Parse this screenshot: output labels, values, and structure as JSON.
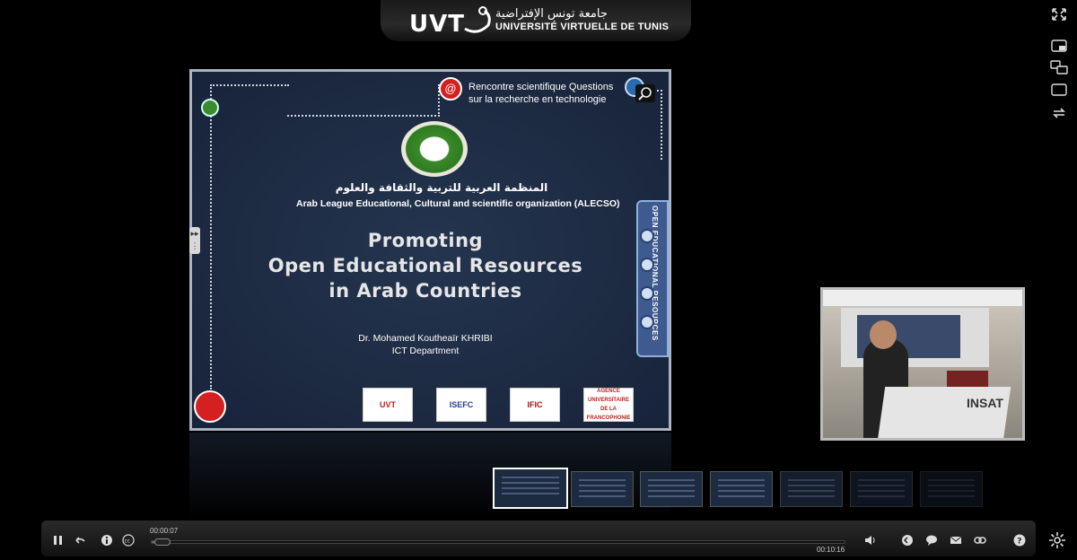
{
  "header": {
    "logo_text": "UVT",
    "arabic_name": "جامعة تونس الإفتراضية",
    "french_name": "UNIVERSITÉ VIRTUELLE DE TUNIS"
  },
  "slide": {
    "rencontre_line1": "Rencontre scientifique Questions",
    "rencontre_line2": "sur la recherche en technologie",
    "org_arabic": "المنظمة العربية للتربية والثقافة والعلوم",
    "org_english": "Arab League Educational, Cultural and scientific organization (ALECSO)",
    "title_line1": "Promoting",
    "title_line2": "Open Educational Resources",
    "title_line3": "in Arab Countries",
    "author_name": "Dr. Mohamed Koutheaïr KHRIBI",
    "author_dept": "ICT Department",
    "oer_band_text": "OPEN EDUCATIONAL RESOURCES",
    "partners": [
      "UVT",
      "ISEFC",
      "IFIC",
      "AGENCE UNIVERSITAIRE DE LA FRANCOPHONIE"
    ]
  },
  "video": {
    "podium_label": "INSAT"
  },
  "player": {
    "current_time": "00:00:07",
    "total_time": "00:10:16",
    "progress_fraction": 0.011
  },
  "icons": {
    "play_pause": "pause-icon",
    "back": "back-icon",
    "info": "info-icon",
    "cc": "cc-icon",
    "volume": "volume-icon",
    "chat": "chat-icon",
    "mail": "mail-icon",
    "link": "link-icon",
    "help": "help-icon"
  }
}
